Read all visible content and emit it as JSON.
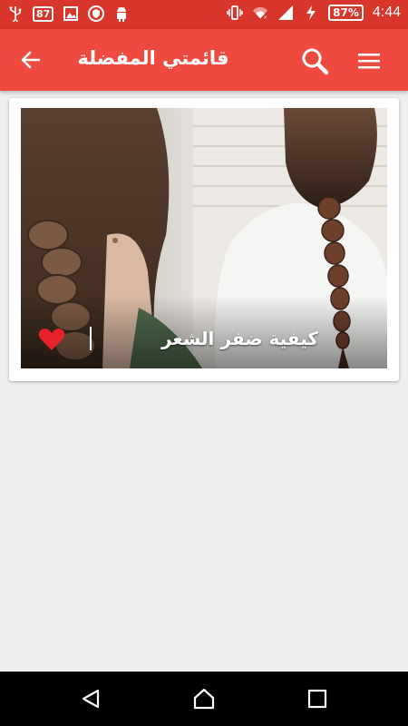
{
  "status_bar": {
    "notification_badge": "87",
    "battery_percent": "87%",
    "time": "4:44",
    "icons": [
      "usb-icon",
      "badge-icon",
      "image-icon",
      "vpn-shield-icon",
      "android-icon",
      "vibrate-icon",
      "wifi-icon",
      "signal-icon",
      "charging-icon",
      "battery-icon"
    ]
  },
  "app_bar": {
    "title": "قائمتي المفضلة",
    "back_icon": "arrow-left-icon",
    "search_icon": "search-icon",
    "menu_icon": "hamburger-menu-icon",
    "color": "#ee4a3f"
  },
  "favorites": [
    {
      "title": "كيفية ضفر الشعر",
      "image": "braided-hair-photo",
      "favorite_icon": "heart-icon",
      "favorited": true,
      "heart_color": "#e8222a"
    }
  ],
  "nav_bar": {
    "buttons": [
      "back-triangle-icon",
      "home-icon",
      "recents-square-icon"
    ]
  }
}
